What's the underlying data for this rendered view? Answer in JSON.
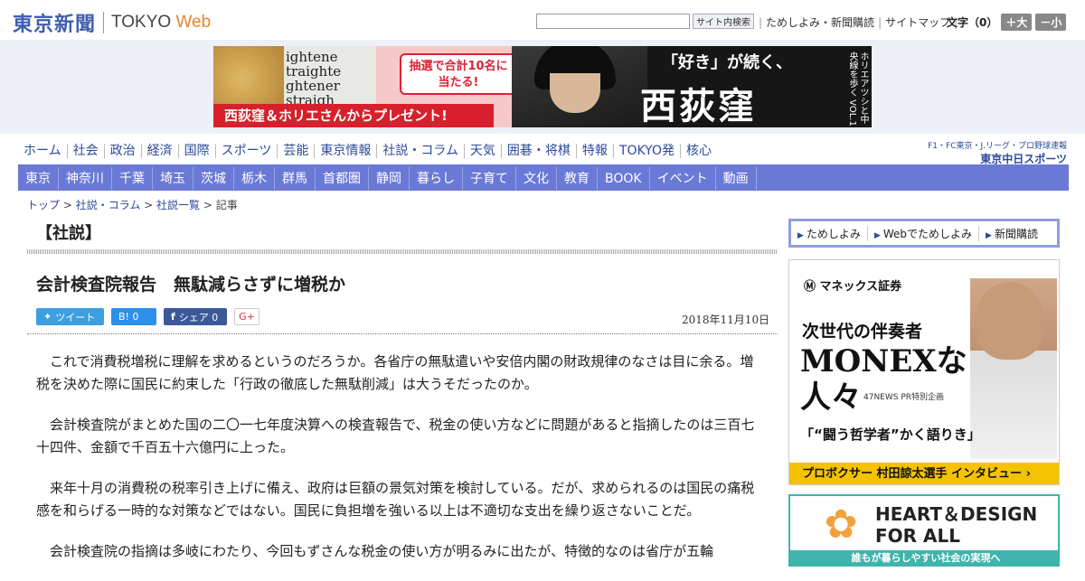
{
  "header": {
    "logo_jp": "東京新聞",
    "logo_en_1": "TOKYO",
    "logo_en_2": "Web",
    "search_button": "サイト内検索",
    "links": [
      "ためしよみ・新聞購読",
      "サイトマップ"
    ],
    "font_label": "文字（0）",
    "font_larger": "＋大",
    "font_smaller": "－小"
  },
  "banner": {
    "paper_text": "ightene\ntraighte\nghtener\nstraigh",
    "bubble": "抽選で合計10名に\n当たる!",
    "strip": "西荻窪＆ホリエさんからプレゼント!",
    "headline": "「好き」が続く、",
    "place": "西荻窪",
    "side": "ホリエアツシと中央線を歩く VOL.1"
  },
  "nav_primary": [
    "ホーム",
    "社会",
    "政治",
    "経済",
    "国際",
    "スポーツ",
    "芸能",
    "東京情報",
    "社説・コラム",
    "天気",
    "囲碁・将棋",
    "特報",
    "TOKYO発",
    "核心"
  ],
  "nav_right": {
    "line1": "F1・FC東京・J.リーグ・プロ野球速報",
    "line2": "東京中日スポーツ"
  },
  "nav_secondary": [
    "東京",
    "神奈川",
    "千葉",
    "埼玉",
    "茨城",
    "栃木",
    "群馬",
    "首都圏",
    "静岡",
    "暮らし",
    "子育て",
    "文化",
    "教育",
    "BOOK",
    "イベント",
    "動画"
  ],
  "breadcrumb": {
    "top": "トップ",
    "sep": " > ",
    "cat": "社説・コラム",
    "list": "社説一覧",
    "current": "記事"
  },
  "article": {
    "section": "【社説】",
    "title": "会計検査院報告　無駄減らさずに増税か",
    "tweet": "ツイート",
    "hatena": "B! 0",
    "share": "シェア 0",
    "gplus": "G+",
    "date": "2018年11月10日",
    "paragraphs": [
      "これで消費税増税に理解を求めるというのだろうか。各省庁の無駄遣いや安倍内閣の財政規律のなさは目に余る。増税を決めた際に国民に約束した「行政の徹底した無駄削減」は大うそだったのか。",
      "会計検査院がまとめた国の二〇一七年度決算への検査報告で、税金の使い方などに問題があると指摘したのは三百七十四件、金額で千百五十六億円に上った。",
      "来年十月の消費税の税率引き上げに備え、政府は巨額の景気対策を検討している。だが、求められるのは国民の痛税感を和らげる一時的な対策などではない。国民に負担増を強いる以上は不適切な支出を繰り返さないことだ。",
      "会計検査院の指摘は多岐にわたり、今回もずさんな税金の使い方が明るみに出たが、特徴的なのは省庁が五輪"
    ]
  },
  "sidebar": {
    "subscribe": [
      "ためしよみ",
      "Webでためしよみ",
      "新聞購読"
    ],
    "ad1": {
      "brand": "マネックス証券",
      "line1": "次世代の伴奏者",
      "line2": "MONEXな",
      "line3": "人々",
      "pr": "47NEWS PR特別企画",
      "quote": "「“闘う哲学者”かく語りき」",
      "footer": "プロボクサー 村田諒太選手 インタビュー ›"
    },
    "ad2": {
      "title_1": "HEART＆DESIGN",
      "title_2": "FOR ALL",
      "footer": "誰もが暮らしやすい社会の実現へ"
    }
  }
}
